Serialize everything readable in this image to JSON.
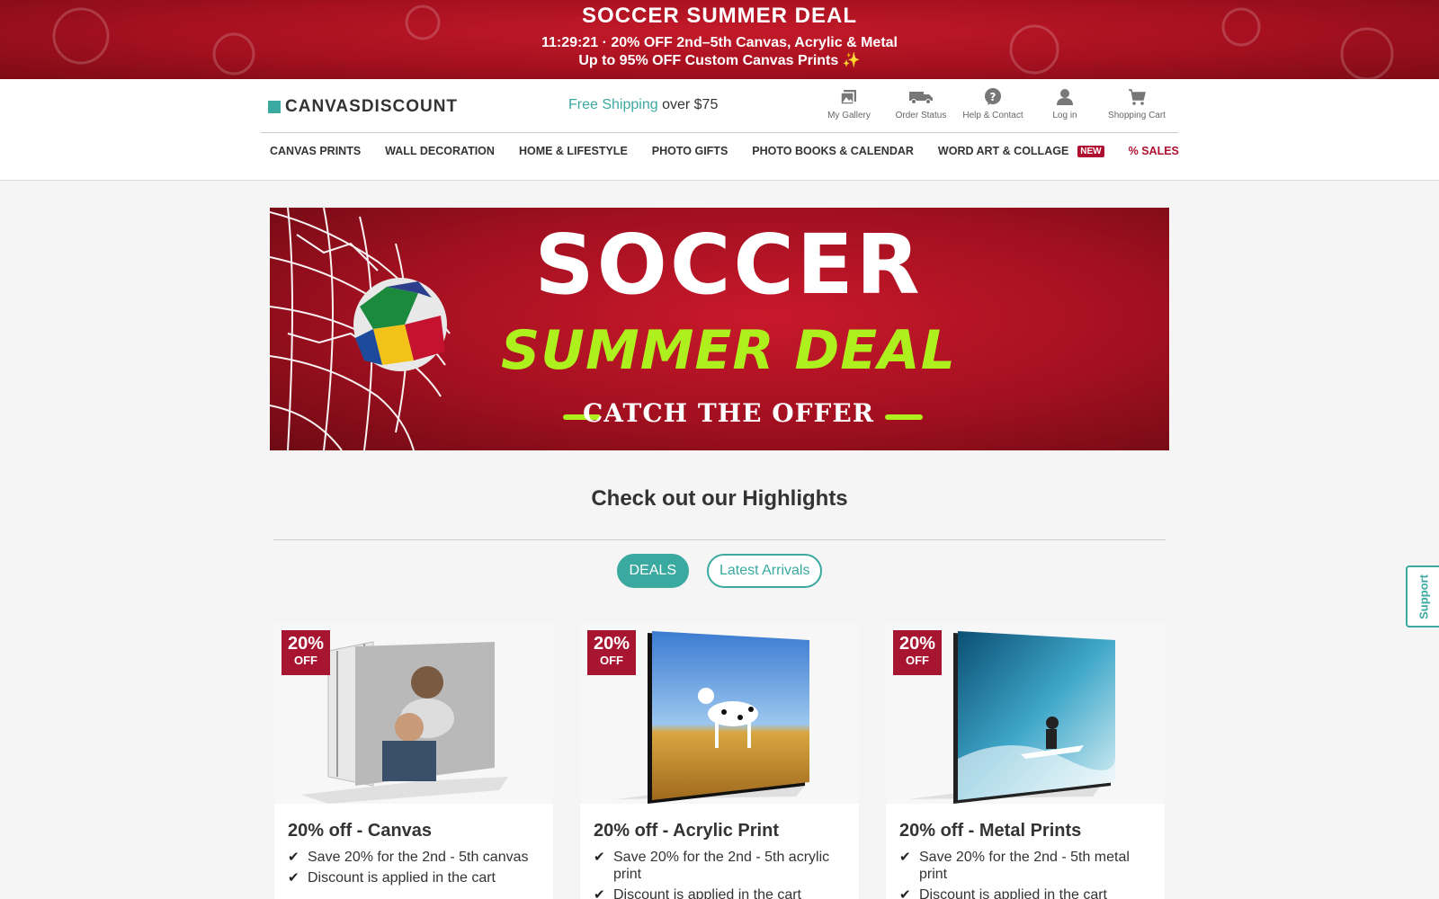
{
  "promo": {
    "title": "SOCCER SUMMER DEAL",
    "line1": "11:29:21 · 20% OFF 2nd–5th Canvas, Acrylic & Metal",
    "line2": "Up to 95% OFF Custom Canvas Prints ✨"
  },
  "header": {
    "logo": "CANVASDISCOUNT",
    "shipping_highlight": "Free Shipping",
    "shipping_rest": "over $75",
    "tools": [
      {
        "label": "My Gallery",
        "icon": "gallery-icon"
      },
      {
        "label": "Order Status",
        "icon": "truck-icon"
      },
      {
        "label": "Help & Contact",
        "icon": "help-icon"
      },
      {
        "label": "Log in",
        "icon": "user-icon"
      },
      {
        "label": "Shopping Cart",
        "icon": "cart-icon"
      }
    ]
  },
  "nav": {
    "items": [
      "CANVAS PRINTS",
      "WALL DECORATION",
      "HOME & LIFESTYLE",
      "PHOTO GIFTS",
      "PHOTO BOOKS & CALENDAR",
      "WORD ART & COLLAGE"
    ],
    "new_badge": "NEW",
    "sales": "% SALES"
  },
  "hero": {
    "title": "SOCCER",
    "subtitle": "SUMMER DEAL",
    "cta": "CATCH THE OFFER"
  },
  "highlights": {
    "title": "Check out our Highlights",
    "tab_deals": "DEALS",
    "tab_latest": "Latest Arrivals"
  },
  "cards": [
    {
      "badge_pct": "20%",
      "badge_off": "OFF",
      "title": "20% off - Canvas",
      "bullets": [
        "Save 20% for the 2nd - 5th canvas",
        "Discount is applied in the cart"
      ]
    },
    {
      "badge_pct": "20%",
      "badge_off": "OFF",
      "title": "20% off - Acrylic Print",
      "bullets": [
        "Save 20% for the 2nd - 5th acrylic print",
        "Discount is applied in the cart"
      ]
    },
    {
      "badge_pct": "20%",
      "badge_off": "OFF",
      "title": "20% off - Metal Prints",
      "bullets": [
        "Save 20% for the 2nd - 5th metal print",
        "Discount is applied in the cart"
      ]
    }
  ],
  "support": "Support",
  "colors": {
    "accent": "#3aa9a0",
    "brand_red": "#a81530",
    "hero_green": "#aef01e"
  }
}
